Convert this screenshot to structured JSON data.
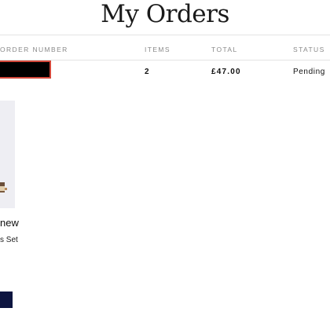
{
  "page": {
    "title": "My Orders"
  },
  "orders_table": {
    "headers": {
      "order_number": "ORDER NUMBER",
      "items": "ITEMS",
      "total": "TOTAL",
      "status": "STATUS"
    },
    "rows": [
      {
        "order_number": "",
        "order_number_redacted": true,
        "items": "2",
        "total": "£47.00",
        "status": "Pending"
      }
    ]
  },
  "product": {
    "name_visible": "new",
    "subtitle_visible": "s Set"
  },
  "colors": {
    "redaction_border": "#d2473a",
    "button_background": "#0d1540",
    "divider": "#e3e3e3",
    "header_text": "#8a8a8a"
  }
}
